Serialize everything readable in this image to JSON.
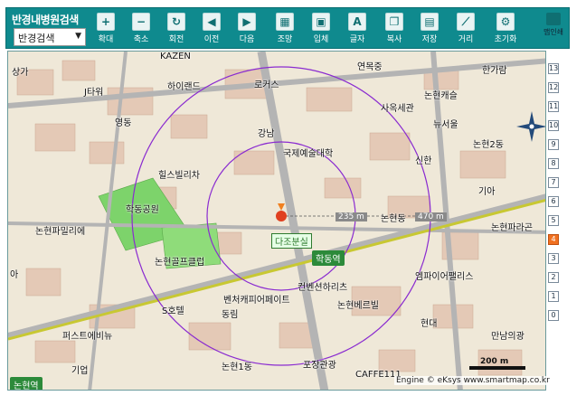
{
  "toolbar": {
    "title": "반경내병원검색",
    "select_value": "반경검색",
    "tools": [
      {
        "label": "확대",
        "icon": "zoom-in-icon",
        "glyph": "+"
      },
      {
        "label": "축소",
        "icon": "zoom-out-icon",
        "glyph": "−"
      },
      {
        "label": "회전",
        "icon": "rotate-icon",
        "glyph": "↻"
      },
      {
        "label": "이전",
        "icon": "back-icon",
        "glyph": "◀"
      },
      {
        "label": "다음",
        "icon": "forward-icon",
        "glyph": "▶"
      },
      {
        "label": "조망",
        "icon": "view-icon",
        "glyph": "▦"
      },
      {
        "label": "입체",
        "icon": "3d-icon",
        "glyph": "▣"
      },
      {
        "label": "글자",
        "icon": "text-icon",
        "glyph": "A"
      },
      {
        "label": "복사",
        "icon": "copy-icon",
        "glyph": "❐"
      },
      {
        "label": "저장",
        "icon": "save-icon",
        "glyph": "▤"
      },
      {
        "label": "거리",
        "icon": "ruler-icon",
        "glyph": "⟋"
      },
      {
        "label": "초기화",
        "icon": "reset-icon",
        "glyph": "⚙"
      }
    ],
    "print_label": "맵인쇄"
  },
  "map": {
    "labels": [
      {
        "text": "상가",
        "cls": ""
      },
      {
        "text": "KAZEN",
        "cls": ""
      },
      {
        "text": "연목중",
        "cls": ""
      },
      {
        "text": "한가람",
        "cls": ""
      },
      {
        "text": "하이랜드",
        "cls": ""
      },
      {
        "text": "로커스",
        "cls": ""
      },
      {
        "text": "J타워",
        "cls": ""
      },
      {
        "text": "논현캐슬",
        "cls": ""
      },
      {
        "text": "사옥세관",
        "cls": ""
      },
      {
        "text": "뉴서울",
        "cls": ""
      },
      {
        "text": "영동",
        "cls": ""
      },
      {
        "text": "강남",
        "cls": ""
      },
      {
        "text": "국제예술대학",
        "cls": ""
      },
      {
        "text": "논현2동",
        "cls": ""
      },
      {
        "text": "신한",
        "cls": ""
      },
      {
        "text": "힐스빌리차",
        "cls": ""
      },
      {
        "text": "기아",
        "cls": ""
      },
      {
        "text": "학동공원",
        "cls": ""
      },
      {
        "text": "논현동",
        "cls": ""
      },
      {
        "text": "논현파밀리에",
        "cls": ""
      },
      {
        "text": "논현파라곤",
        "cls": ""
      },
      {
        "text": "논현골프클럽",
        "cls": ""
      },
      {
        "text": "엠파이어팰리스",
        "cls": ""
      },
      {
        "text": "아",
        "cls": ""
      },
      {
        "text": "컨벤션하리츠",
        "cls": ""
      },
      {
        "text": "벤처캐피어페이트",
        "cls": ""
      },
      {
        "text": "논현베르빌",
        "cls": ""
      },
      {
        "text": "S호텔",
        "cls": ""
      },
      {
        "text": "동림",
        "cls": ""
      },
      {
        "text": "현대",
        "cls": ""
      },
      {
        "text": "퍼스트에비뉴",
        "cls": ""
      },
      {
        "text": "만남의광",
        "cls": ""
      },
      {
        "text": "기업",
        "cls": ""
      },
      {
        "text": "논현1동",
        "cls": ""
      },
      {
        "text": "포장관광",
        "cls": ""
      },
      {
        "text": "CAFFE111",
        "cls": ""
      }
    ],
    "stations": [
      {
        "text": "학동역"
      },
      {
        "text": "논현역"
      }
    ],
    "target_label": "다조분실",
    "distance_left": "235 m",
    "distance_right": "470 m",
    "scale_label": "200 m",
    "footer": "Engine © eKsys www.smartmap.co.kr"
  },
  "zoom_bar": [
    "13",
    "12",
    "11",
    "10",
    "9",
    "8",
    "7",
    "6",
    "5",
    "4",
    "3",
    "2",
    "1",
    "0"
  ],
  "zoom_active": "4",
  "colors": {
    "toolbar_bg": "#0f8a8e",
    "park": "#7dd36b",
    "radius_circle": "#8a2bd0",
    "road_major": "#a8a8a8",
    "road_subway": "#c8c832",
    "station_bg": "#2c8a3a"
  }
}
